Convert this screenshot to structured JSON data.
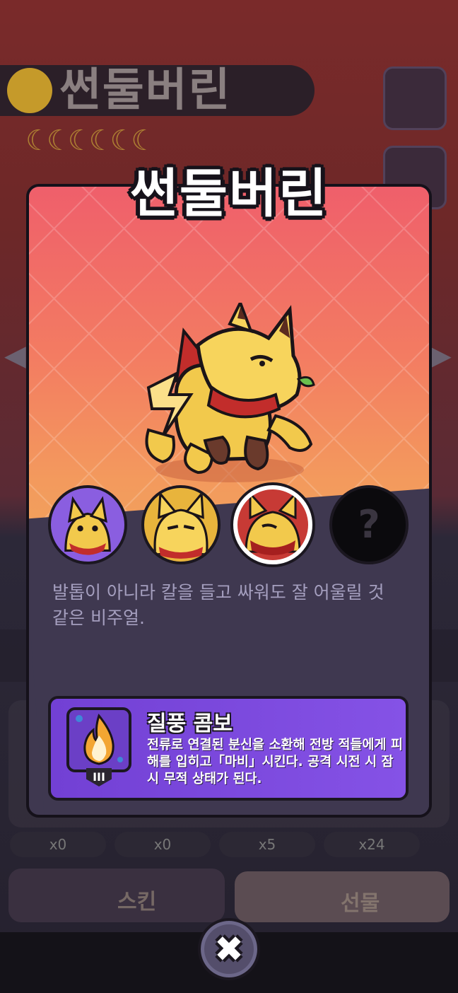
{
  "background": {
    "title": "썬둘버린",
    "moons": "☾☾☾☾☾☾",
    "left_arrow": "◀",
    "right_arrow": "▶",
    "stats": [
      "x0",
      "x0",
      "x5",
      "x24"
    ],
    "skin_button_label": "스킨",
    "gift_button_label": "선물"
  },
  "card": {
    "title": "썬둘버린",
    "description": "발톱이 아니라 칼을 들고 싸워도 잘 어울릴 것 같은 비주얼.",
    "skins": [
      {
        "name": "skin-1",
        "background": "#8a5ee0",
        "selected": false
      },
      {
        "name": "skin-2",
        "background": "#e8b43c",
        "selected": false
      },
      {
        "name": "skin-3",
        "background": "#c73a35",
        "selected": true
      },
      {
        "name": "skin-4",
        "background": "#0b0a0d",
        "locked": true,
        "label": "?"
      }
    ],
    "skill": {
      "name": "질풍 콤보",
      "level": "III",
      "description": "전류로 연결된 분신을 소환해 전방 적들에게 피해를 입히고「마비」시킨다. 공격 시전 시 잠시 무적 상태가 된다.",
      "icon": "flame-icon"
    }
  },
  "close_button": {
    "label": "✖",
    "icon": "close-icon"
  },
  "colors": {
    "card_top": "#ef5f6b",
    "card_bottom": "#f0a35c",
    "panel": "#3f3850",
    "skill_bg": "#7240d4",
    "desc_text": "#a59fbf"
  }
}
